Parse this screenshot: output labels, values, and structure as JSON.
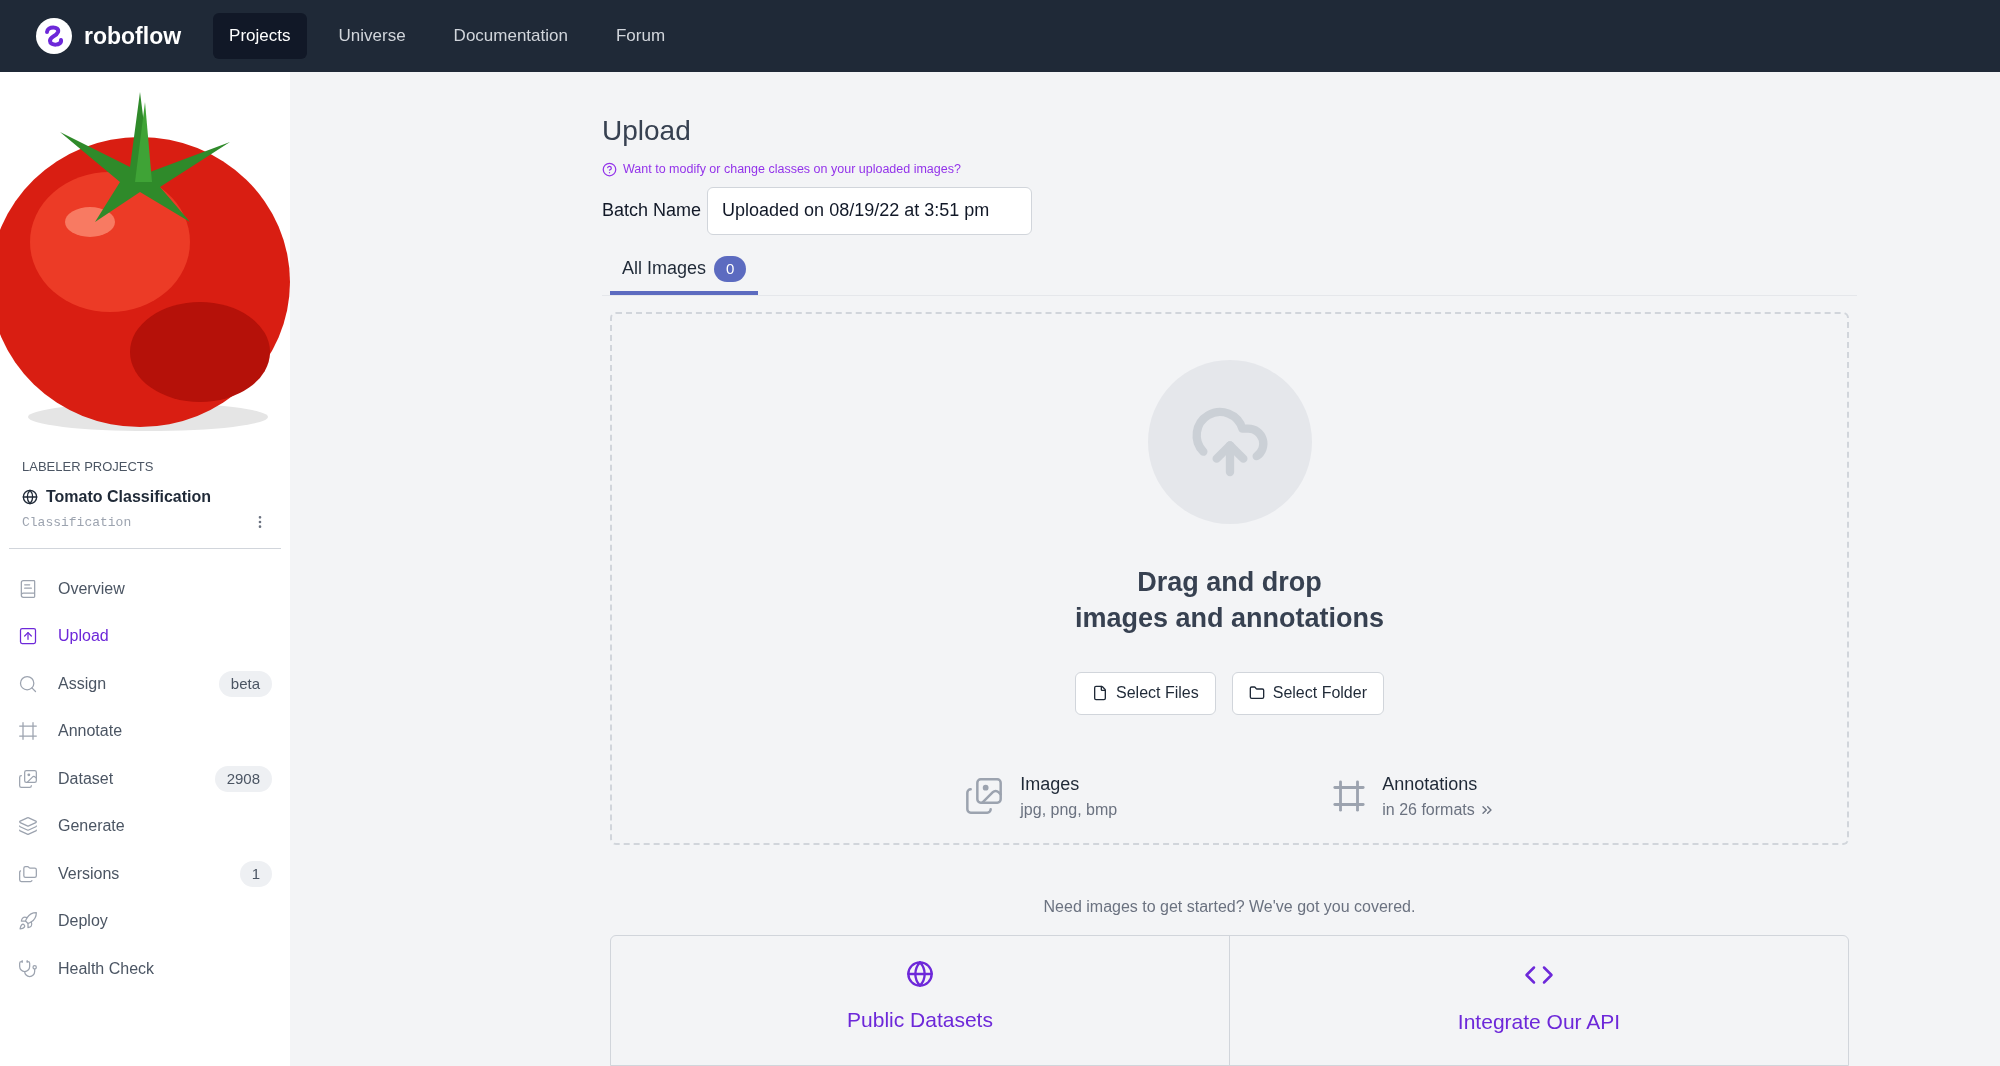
{
  "brand": {
    "name": "roboflow"
  },
  "nav": [
    {
      "label": "Projects",
      "selected": true
    },
    {
      "label": "Universe",
      "selected": false
    },
    {
      "label": "Documentation",
      "selected": false
    },
    {
      "label": "Forum",
      "selected": false
    }
  ],
  "sidebar": {
    "section_label": "LABELER PROJECTS",
    "project_name": "Tomato Classification",
    "project_type": "Classification",
    "items": [
      {
        "kind": "overview",
        "label": "Overview",
        "selected": false
      },
      {
        "kind": "upload",
        "label": "Upload",
        "selected": true
      },
      {
        "kind": "assign",
        "label": "Assign",
        "badge": "beta",
        "selected": false
      },
      {
        "kind": "annotate",
        "label": "Annotate",
        "selected": false
      },
      {
        "kind": "dataset",
        "label": "Dataset",
        "badge": "2908",
        "selected": false
      },
      {
        "kind": "generate",
        "label": "Generate",
        "selected": false
      },
      {
        "kind": "versions",
        "label": "Versions",
        "badge": "1",
        "selected": false
      },
      {
        "kind": "deploy",
        "label": "Deploy",
        "selected": false
      },
      {
        "kind": "health",
        "label": "Health Check",
        "selected": false
      }
    ]
  },
  "main": {
    "title": "Upload",
    "help_link": "Want to modify or change classes on your uploaded images?",
    "batch_label": "Batch Name",
    "batch_value": "Uploaded on 08/19/22 at 3:51 pm",
    "tabs": [
      {
        "label": "All Images",
        "count": "0",
        "selected": true
      }
    ],
    "dropzone": {
      "title_lines": [
        "Drag and drop",
        "images and annotations"
      ],
      "buttons": [
        {
          "kind": "file",
          "label": "Select Files"
        },
        {
          "kind": "folder",
          "label": "Select Folder"
        }
      ],
      "formats": [
        {
          "kind": "images",
          "title": "Images",
          "subtitle": "jpg, png, bmp"
        },
        {
          "kind": "annotations",
          "title": "Annotations",
          "subtitle": "in 26 formats"
        }
      ]
    },
    "help_text": "Need images to get started? We've got you covered.",
    "cards": [
      {
        "kind": "globe",
        "title": "Public Datasets"
      },
      {
        "kind": "code",
        "title": "Integrate Our API"
      }
    ]
  }
}
